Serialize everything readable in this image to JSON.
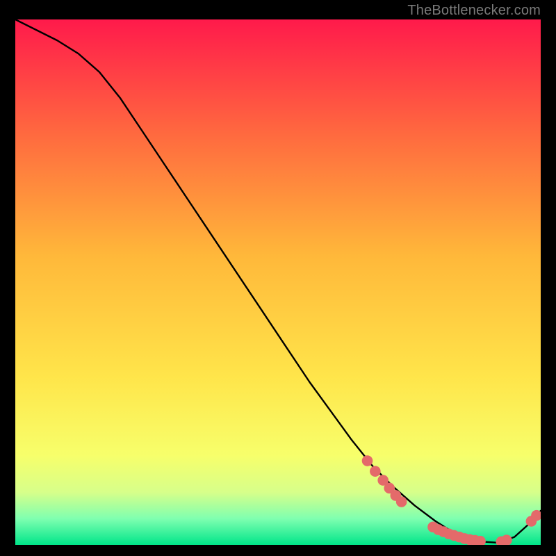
{
  "attribution": "TheBottlenecker.com",
  "colors": {
    "bg_black": "#000000",
    "grad_top": "#ff1a4b",
    "grad_mid1": "#ff6a3f",
    "grad_mid2": "#ffb83a",
    "grad_mid3": "#ffe54a",
    "grad_low1": "#f7ff6b",
    "grad_low2": "#d7ff8a",
    "grad_low3": "#7fffb0",
    "grad_bottom": "#00e58a",
    "line": "#000000",
    "marker": "#e46a6a"
  },
  "chart_data": {
    "type": "line",
    "title": "",
    "xlabel": "",
    "ylabel": "",
    "xlim": [
      0,
      100
    ],
    "ylim": [
      0,
      100
    ],
    "grid": false,
    "legend": false,
    "series": [
      {
        "name": "curve",
        "x": [
          0,
          4,
          8,
          12,
          16,
          20,
          24,
          28,
          32,
          36,
          40,
          44,
          48,
          52,
          56,
          60,
          64,
          68,
          72,
          76,
          80,
          83,
          86,
          89,
          92,
          95,
          98,
          100
        ],
        "y": [
          100,
          98,
          96,
          93.5,
          90,
          85,
          79,
          73,
          67,
          61,
          55,
          49,
          43,
          37,
          31,
          25.5,
          20,
          15,
          11,
          7.5,
          4.5,
          2.6,
          1.4,
          0.6,
          0.4,
          1.5,
          4.2,
          6.5
        ]
      }
    ],
    "markers": [
      {
        "x": 67.0,
        "y": 16.0
      },
      {
        "x": 68.5,
        "y": 14.0
      },
      {
        "x": 70.0,
        "y": 12.3
      },
      {
        "x": 71.2,
        "y": 10.8
      },
      {
        "x": 72.4,
        "y": 9.4
      },
      {
        "x": 73.5,
        "y": 8.2
      },
      {
        "x": 79.5,
        "y": 3.4
      },
      {
        "x": 80.5,
        "y": 2.9
      },
      {
        "x": 81.5,
        "y": 2.5
      },
      {
        "x": 82.5,
        "y": 2.1
      },
      {
        "x": 83.5,
        "y": 1.8
      },
      {
        "x": 84.5,
        "y": 1.5
      },
      {
        "x": 85.5,
        "y": 1.2
      },
      {
        "x": 86.5,
        "y": 1.0
      },
      {
        "x": 87.5,
        "y": 0.85
      },
      {
        "x": 88.5,
        "y": 0.7
      },
      {
        "x": 92.5,
        "y": 0.6
      },
      {
        "x": 93.5,
        "y": 0.9
      },
      {
        "x": 98.2,
        "y": 4.5
      },
      {
        "x": 99.2,
        "y": 5.6
      }
    ]
  }
}
